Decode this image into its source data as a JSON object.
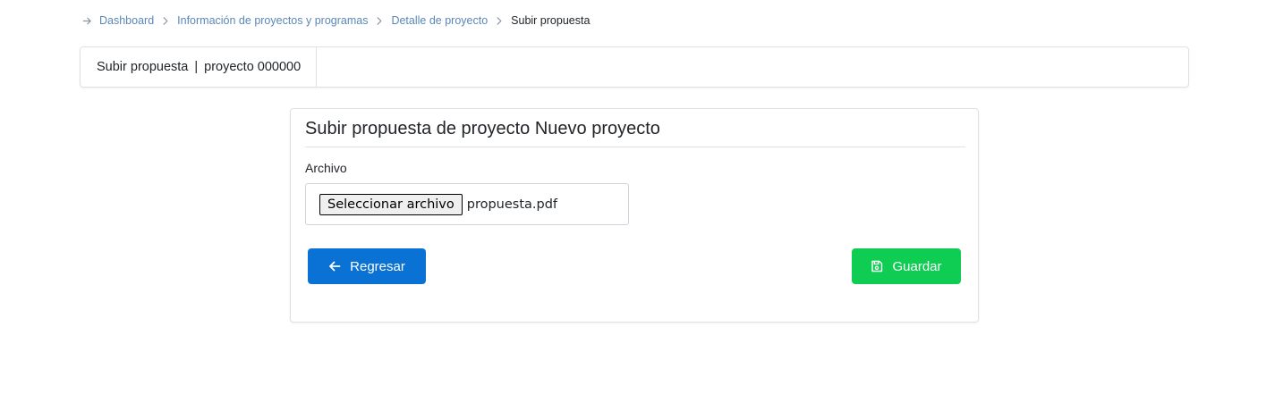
{
  "breadcrumb": {
    "items": [
      {
        "label": "Dashboard"
      },
      {
        "label": "Información de proyectos y programas"
      },
      {
        "label": "Detalle de proyecto"
      }
    ],
    "current": "Subir propuesta"
  },
  "header": {
    "title": "Subir propuesta",
    "separator": "|",
    "project": "proyecto 000000"
  },
  "form": {
    "title": "Subir propuesta de proyecto Nuevo proyecto",
    "file_label": "Archivo",
    "file_button": "Seleccionar archivo",
    "file_name": "propuesta.pdf",
    "back_label": "Regresar",
    "save_label": "Guardar"
  },
  "colors": {
    "link": "#5a87b8",
    "back_button": "#0a72d4",
    "save_button": "#0fcc53"
  },
  "icons": {
    "breadcrumb_start": "arrow-right-icon",
    "breadcrumb_separator": "chevron-right-icon",
    "back": "arrow-left-icon",
    "save": "floppy-disk-icon"
  }
}
